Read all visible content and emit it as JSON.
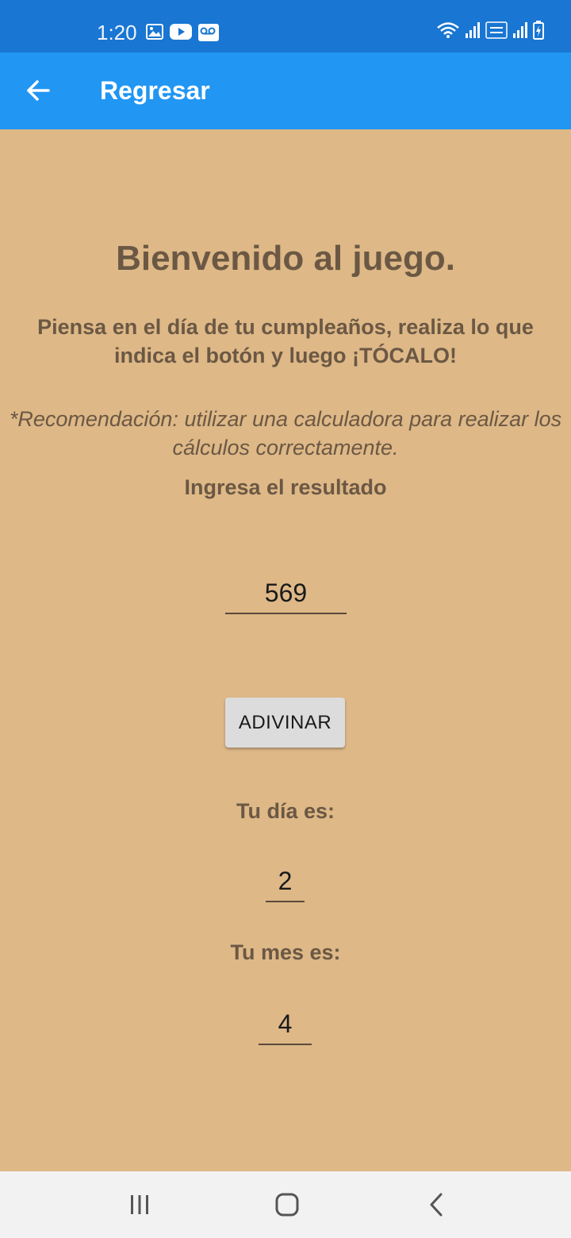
{
  "status_bar": {
    "time": "1:20",
    "left_icons": [
      "image-icon",
      "youtube-icon",
      "voicemail-icon"
    ],
    "right_icons": [
      "wifi-icon",
      "signal-icon",
      "volte-lte2-icon",
      "signal-icon",
      "battery-charging-icon"
    ]
  },
  "app_bar": {
    "title": "Regresar",
    "back_icon": "arrow-left-icon"
  },
  "main": {
    "welcome": "Bienvenido al juego.",
    "instructions": "Piensa en el día de tu cumpleaños, realiza lo que indica el botón y luego ¡TÓCALO!",
    "recommendation": "*Recomendación: utilizar una calculadora para realizar los cálculos correctamente.",
    "result_label": "Ingresa el resultado",
    "result_value": "569",
    "guess_button": "ADIVINAR",
    "day_label": "Tu día es:",
    "day_value": "2",
    "month_label": "Tu mes es:",
    "month_value": "4"
  },
  "nav_bar": {
    "icons": [
      "recent-apps-icon",
      "home-icon",
      "back-icon"
    ]
  },
  "colors": {
    "status_bar": "#1976D2",
    "app_bar": "#2196F3",
    "background": "#DEB887",
    "text": "#6B5844",
    "button": "#DCDCDC",
    "nav_bar": "#F2F2F2"
  }
}
